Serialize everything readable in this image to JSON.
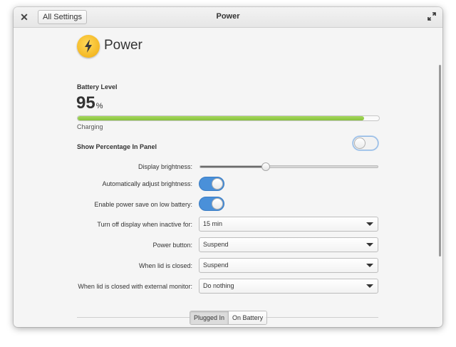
{
  "titlebar": {
    "title": "Power",
    "back_label": "All Settings",
    "close_icon": "close-icon",
    "maximize_icon": "maximize-icon"
  },
  "header": {
    "title": "Power",
    "icon": "lightning-bolt-icon",
    "icon_color": "#f4b824"
  },
  "battery": {
    "label": "Battery Level",
    "value": "95",
    "unit": "%",
    "level_fraction": 0.95,
    "status": "Charging",
    "bar_color": "#86c23a"
  },
  "show_percentage": {
    "label": "Show Percentage In Panel",
    "enabled": false
  },
  "display_brightness": {
    "label": "Display brightness:",
    "value_fraction": 0.37
  },
  "auto_brightness": {
    "label": "Automatically adjust brightness:",
    "enabled": true
  },
  "power_save": {
    "label": "Enable power save on low battery:",
    "enabled": true
  },
  "turn_off_display": {
    "label": "Turn off display when inactive for:",
    "value": "15 min"
  },
  "power_button": {
    "label": "Power button:",
    "value": "Suspend"
  },
  "lid_closed": {
    "label": "When lid is closed:",
    "value": "Suspend"
  },
  "lid_closed_external": {
    "label": "When lid is closed with external monitor:",
    "value": "Do nothing"
  },
  "mode_switch": {
    "options": [
      "Plugged In",
      "On Battery"
    ],
    "selected": "Plugged In"
  },
  "accent_color": "#4a90d9"
}
